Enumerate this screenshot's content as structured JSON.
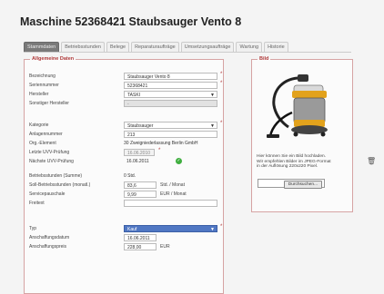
{
  "title": "Maschine 52368421 Staubsauger Vento 8",
  "tabs": [
    {
      "label": "Stammdaten",
      "active": true
    },
    {
      "label": "Betriebsstunden",
      "active": false
    },
    {
      "label": "Belege",
      "active": false
    },
    {
      "label": "Reparaturaufträge",
      "active": false
    },
    {
      "label": "Umsetzungsaufträge",
      "active": false
    },
    {
      "label": "Wartung",
      "active": false
    },
    {
      "label": "Historie",
      "active": false
    }
  ],
  "general": {
    "legend": "Allgemeine Daten",
    "rows": {
      "bezeichnung": {
        "label": "Bezeichnung",
        "value": "Staubsauger Vento 8"
      },
      "seriennummer": {
        "label": "Seriennummer",
        "value": "52368421"
      },
      "hersteller": {
        "label": "Hersteller",
        "value": "TASKI"
      },
      "sonstiger_hersteller": {
        "label": "Sonstiger Hersteller",
        "value": "-"
      },
      "kategorie": {
        "label": "Kategorie",
        "value": "Staubsauger"
      },
      "anlagennummer": {
        "label": "Anlagennummer",
        "value": "213"
      },
      "org_element": {
        "label": "Org.-Element",
        "value": "30 Zweigniederlassung Berlin GmbH"
      },
      "letzte_uvv": {
        "label": "Letzte UVV-Prüfung",
        "value": "16.06.2010"
      },
      "naechste_uvv": {
        "label": "Nächste UVV-Prüfung",
        "value": "16.06.2011"
      },
      "betriebsstunden_summe": {
        "label": "Betriebsstunden (Summe)",
        "value": "0 Std."
      },
      "soll_betriebsstunden": {
        "label": "Soll-Betriebsstunden (monatl.)",
        "value": "83,6",
        "unit": "Std. / Monat"
      },
      "servicepauschale": {
        "label": "Servicepauschale",
        "value": "9,99",
        "unit": "EUR / Monat"
      },
      "freitext": {
        "label": "Freitext",
        "value": ""
      },
      "typ": {
        "label": "Typ",
        "value": "Kauf"
      },
      "anschaffungsdatum": {
        "label": "Anschaffungsdatum",
        "value": "16.06.2011"
      },
      "anschaffungspreis": {
        "label": "Anschaffungspreis",
        "value": "228,00",
        "unit": "EUR"
      }
    }
  },
  "picture": {
    "legend": "Bild",
    "info_line1": "Hier können Sie ein Bild hochladen.",
    "info_line2": "Wir empfehlen Bilder im JPEG-Format",
    "info_line3": "in der Auflösung 220x220 Pixel.",
    "browse_label": "Durchsuchen..."
  },
  "colors": {
    "accent": "#b03a3a",
    "selected": "#5077c3",
    "ok": "#3fae3f"
  },
  "icons": [
    "dropdown-arrow-icon",
    "check-icon",
    "trash-icon"
  ]
}
